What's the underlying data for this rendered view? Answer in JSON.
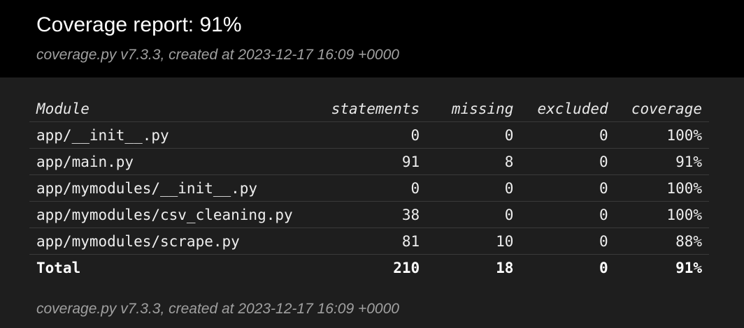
{
  "header": {
    "title": "Coverage report: 91%",
    "created": "coverage.py v7.3.3, created at 2023-12-17 16:09 +0000"
  },
  "table": {
    "columns": {
      "module": "Module",
      "statements": "statements",
      "missing": "missing",
      "excluded": "excluded",
      "coverage": "coverage"
    },
    "rows": [
      {
        "module": "app/__init__.py",
        "statements": "0",
        "missing": "0",
        "excluded": "0",
        "coverage": "100%"
      },
      {
        "module": "app/main.py",
        "statements": "91",
        "missing": "8",
        "excluded": "0",
        "coverage": "91%"
      },
      {
        "module": "app/mymodules/__init__.py",
        "statements": "0",
        "missing": "0",
        "excluded": "0",
        "coverage": "100%"
      },
      {
        "module": "app/mymodules/csv_cleaning.py",
        "statements": "38",
        "missing": "0",
        "excluded": "0",
        "coverage": "100%"
      },
      {
        "module": "app/mymodules/scrape.py",
        "statements": "81",
        "missing": "10",
        "excluded": "0",
        "coverage": "88%"
      }
    ],
    "total": {
      "module": "Total",
      "statements": "210",
      "missing": "18",
      "excluded": "0",
      "coverage": "91%"
    }
  },
  "footer": {
    "created": "coverage.py v7.3.3, created at 2023-12-17 16:09 +0000"
  },
  "colors": {
    "header_bg": "#000000",
    "body_bg": "#1e1e1e",
    "text": "#eeeeee",
    "muted": "#a0a0a0",
    "row_border": "#3a3a3a"
  }
}
